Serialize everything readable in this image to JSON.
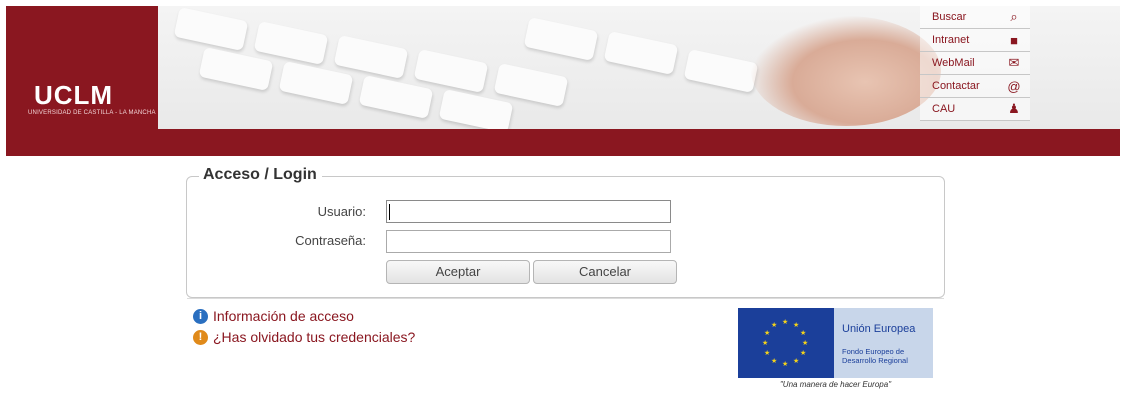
{
  "header": {
    "logo_text": "UCLM",
    "logo_sub": "UNIVERSIDAD DE CASTILLA - LA MANCHA",
    "quicklinks": [
      {
        "label": "Buscar",
        "icon": "search-icon"
      },
      {
        "label": "Intranet",
        "icon": "briefcase-icon"
      },
      {
        "label": "WebMail",
        "icon": "mail-icon"
      },
      {
        "label": "Contactar",
        "icon": "contact-icon"
      },
      {
        "label": "CAU",
        "icon": "support-icon"
      }
    ]
  },
  "login": {
    "legend": "Acceso / Login",
    "user_label": "Usuario:",
    "user_value": "",
    "password_label": "Contraseña:",
    "password_value": "",
    "accept_label": "Aceptar",
    "cancel_label": "Cancelar"
  },
  "links": {
    "info": "Información de acceso",
    "forgot": "¿Has olvidado tus credenciales?"
  },
  "eu": {
    "title": "Unión Europea",
    "fund": "Fondo Europeo de Desarrollo Regional",
    "motto": "\"Una manera de hacer Europa\""
  },
  "colors": {
    "brand": "#8a1720",
    "link": "#8a1720",
    "eu_blue": "#1b3f9a"
  }
}
